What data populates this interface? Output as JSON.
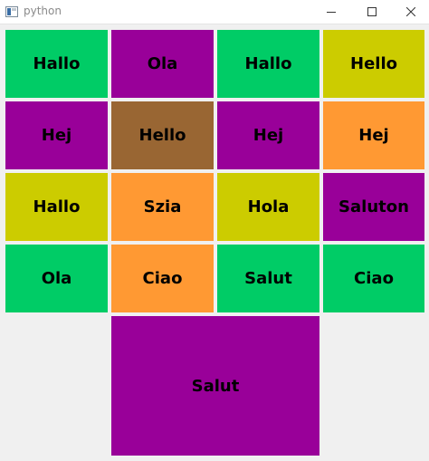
{
  "window": {
    "title": "python",
    "buttons": {
      "minimize": "minimize-icon",
      "maximize": "maximize-icon",
      "close": "close-icon"
    }
  },
  "colors": {
    "green": "#00cc66",
    "purple": "#990099",
    "yellow": "#cccc00",
    "brown": "#996633",
    "orange": "#ff9933"
  },
  "grid": {
    "rows": [
      [
        {
          "label": "Hallo",
          "color": "#00cc66"
        },
        {
          "label": "Ola",
          "color": "#990099"
        },
        {
          "label": "Hallo",
          "color": "#00cc66"
        },
        {
          "label": "Hello",
          "color": "#cccc00"
        }
      ],
      [
        {
          "label": "Hej",
          "color": "#990099"
        },
        {
          "label": "Hello",
          "color": "#996633"
        },
        {
          "label": "Hej",
          "color": "#990099"
        },
        {
          "label": "Hej",
          "color": "#ff9933"
        }
      ],
      [
        {
          "label": "Hallo",
          "color": "#cccc00"
        },
        {
          "label": "Szia",
          "color": "#ff9933"
        },
        {
          "label": "Hola",
          "color": "#cccc00"
        },
        {
          "label": "Saluton",
          "color": "#990099"
        }
      ],
      [
        {
          "label": "Ola",
          "color": "#00cc66"
        },
        {
          "label": "Ciao",
          "color": "#ff9933"
        },
        {
          "label": "Salut",
          "color": "#00cc66"
        },
        {
          "label": "Ciao",
          "color": "#00cc66"
        }
      ]
    ],
    "spanning_tile": {
      "label": "Salut",
      "color": "#990099"
    }
  }
}
